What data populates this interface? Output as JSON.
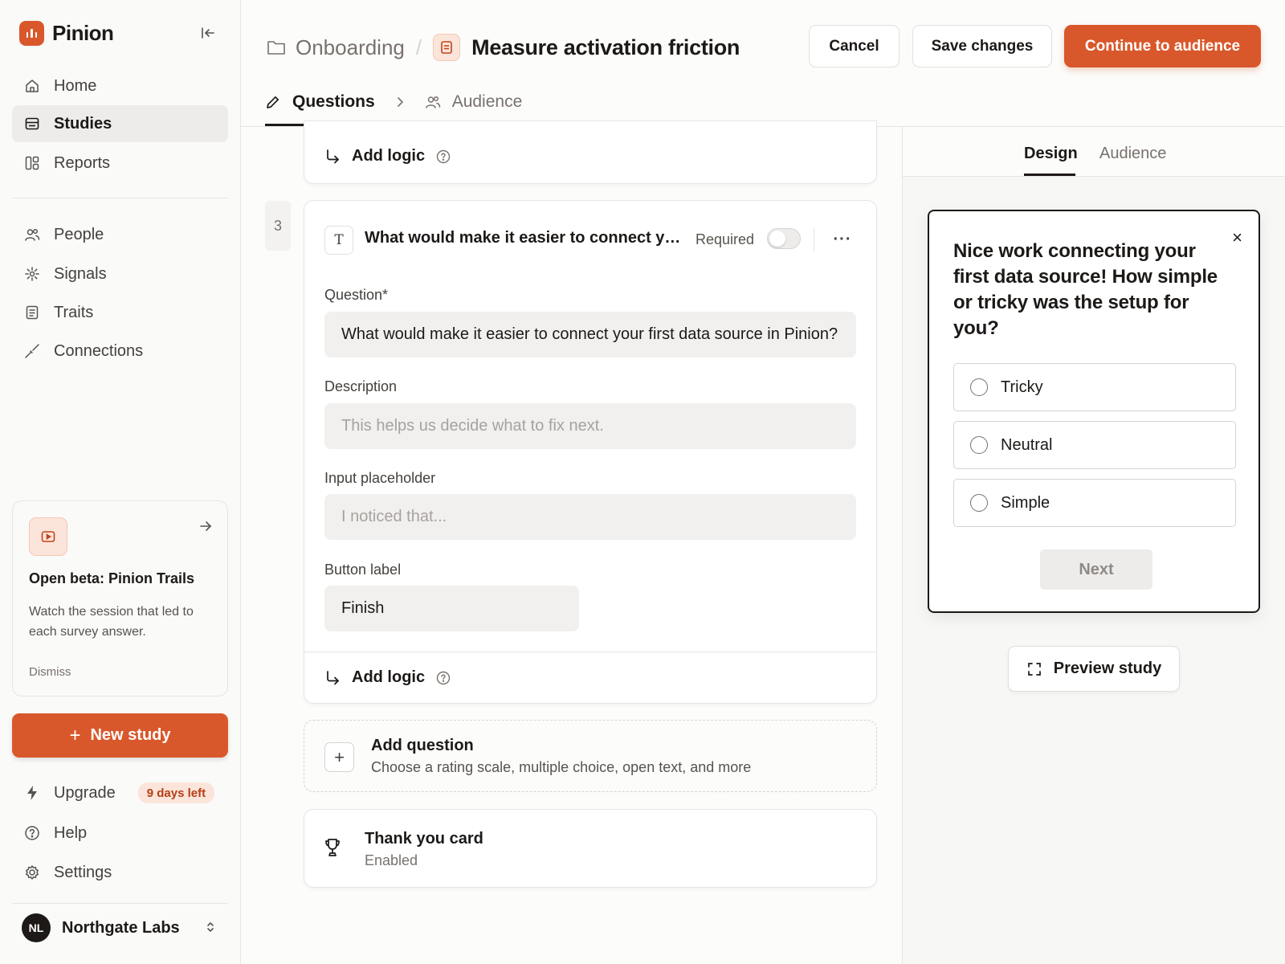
{
  "app": {
    "name": "Pinion"
  },
  "sidebar": {
    "primary": [
      {
        "label": "Home",
        "icon": "home-icon"
      },
      {
        "label": "Studies",
        "icon": "studies-icon",
        "active": true
      },
      {
        "label": "Reports",
        "icon": "reports-icon"
      }
    ],
    "secondary": [
      {
        "label": "People",
        "icon": "people-icon"
      },
      {
        "label": "Signals",
        "icon": "signals-icon"
      },
      {
        "label": "Traits",
        "icon": "traits-icon"
      },
      {
        "label": "Connections",
        "icon": "connections-icon"
      }
    ],
    "promo": {
      "title": "Open beta: Pinion Trails",
      "text": "Watch the session that led to each survey answer.",
      "dismiss": "Dismiss"
    },
    "new_study": "New study",
    "footer": [
      {
        "label": "Upgrade",
        "icon": "bolt-icon",
        "badge": "9 days left"
      },
      {
        "label": "Help",
        "icon": "help-icon"
      },
      {
        "label": "Settings",
        "icon": "settings-icon"
      }
    ],
    "account": {
      "initials": "NL",
      "name": "Northgate Labs"
    }
  },
  "header": {
    "breadcrumb_parent": "Onboarding",
    "breadcrumb_sep": "/",
    "title": "Measure activation friction",
    "cancel": "Cancel",
    "save": "Save changes",
    "continue": "Continue to audience",
    "steps": [
      {
        "label": "Questions",
        "active": true
      },
      {
        "label": "Audience",
        "active": false
      }
    ]
  },
  "editor": {
    "prev_card": {
      "add_logic": "Add logic"
    },
    "question_card": {
      "number": "3",
      "type_glyph": "T",
      "title": "What would make it easier to connect your first data source in Pinion?",
      "required_label": "Required",
      "required": false,
      "more": "···",
      "fields": {
        "question_label": "Question*",
        "question_value": "What would make it easier to connect your first data source in Pinion?",
        "description_label": "Description",
        "description_placeholder": "This helps us decide what to fix next.",
        "placeholder_label": "Input placeholder",
        "placeholder_placeholder": "I noticed that...",
        "button_label": "Button label",
        "button_value": "Finish"
      },
      "add_logic": "Add logic"
    },
    "add_question": {
      "title": "Add question",
      "subtitle": "Choose a rating scale, multiple choice, open text, and more"
    },
    "thank_you": {
      "title": "Thank you card",
      "status": "Enabled"
    }
  },
  "right_panel": {
    "tabs": [
      {
        "label": "Design",
        "active": true
      },
      {
        "label": "Audience",
        "active": false
      }
    ],
    "preview": {
      "question": "Nice work connecting your first data source! How simple or tricky was the setup for you?",
      "options": [
        "Tricky",
        "Neutral",
        "Simple"
      ],
      "next": "Next",
      "close": "×"
    },
    "preview_button": "Preview study"
  },
  "colors": {
    "accent": "#d9582b",
    "accent_soft": "#fbe4da",
    "text": "#1c1917",
    "muted": "#78716c"
  }
}
